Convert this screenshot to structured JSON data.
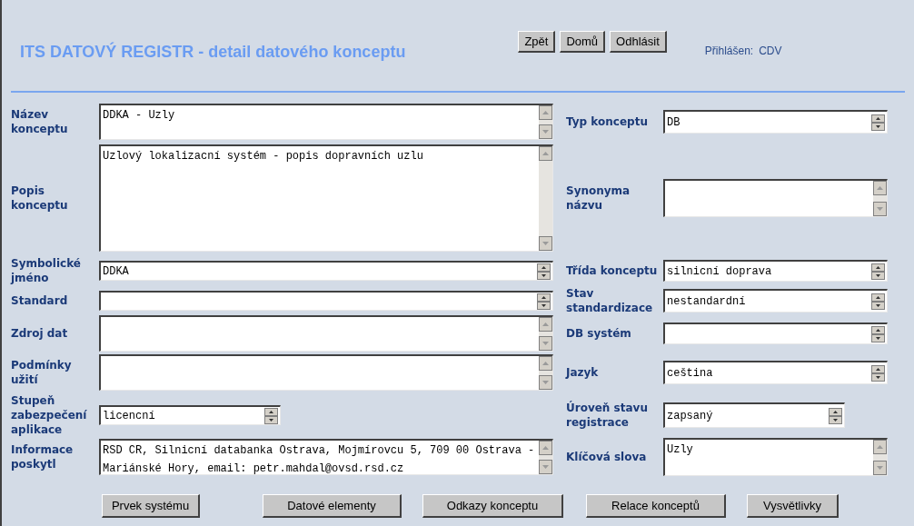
{
  "header": {
    "title": "ITS DATOVÝ REGISTR - detail datového konceptu",
    "nav_buttons": [
      "Zpět",
      "Domů",
      "Odhlásit"
    ],
    "user_label": "Přihlášen:",
    "user_name": "CDV"
  },
  "left_fields": [
    {
      "label": "Název konceptu",
      "value": "DDKA - Uzly",
      "kind": "textarea"
    },
    {
      "label": "Popis konceptu",
      "value": "Uzlový lokalizacní systém - popis dopravních uzlu",
      "kind": "textarea"
    },
    {
      "label": "Symbolické jméno",
      "value": "DDKA",
      "kind": "select"
    },
    {
      "label": "Standard",
      "kind": "select"
    },
    {
      "label": "Zdroj dat",
      "kind": "textarea"
    },
    {
      "label": "Podmínky užití",
      "kind": "textarea"
    },
    {
      "label": "Stupeň zabezpečení aplikace",
      "value": "licencní",
      "kind": "select-short"
    },
    {
      "label": "Informace poskytl",
      "value": "RSD CR, Silnicní databanka Ostrava, Mojmírovcu 5, 709 00 Ostrava - Mariánské Hory, email: petr.mahdal@ovsd.rsd.cz",
      "kind": "textarea"
    }
  ],
  "right_fields": [
    {
      "label": "Typ konceptu",
      "value": "DB",
      "kind": "select"
    },
    {
      "label": "Synonyma názvu",
      "kind": "textarea"
    },
    {
      "label": "Třída konceptu",
      "value": "silnicní doprava",
      "kind": "select"
    },
    {
      "label": "Stav standardizace",
      "value": "nestandardní",
      "kind": "select"
    },
    {
      "label": "DB systém",
      "kind": "select"
    },
    {
      "label": "Jazyk",
      "value": "ceština",
      "kind": "select"
    },
    {
      "label": "Úroveň  stavu registrace",
      "value": "zapsaný",
      "kind": "select-short"
    },
    {
      "label": "Klíčová slova",
      "value": "Uzly",
      "kind": "textarea"
    }
  ],
  "bottom_buttons": [
    "Prvek systému",
    "Datové elementy",
    "Odkazy konceptu",
    "Relace konceptů",
    "Vysvětlivky"
  ]
}
